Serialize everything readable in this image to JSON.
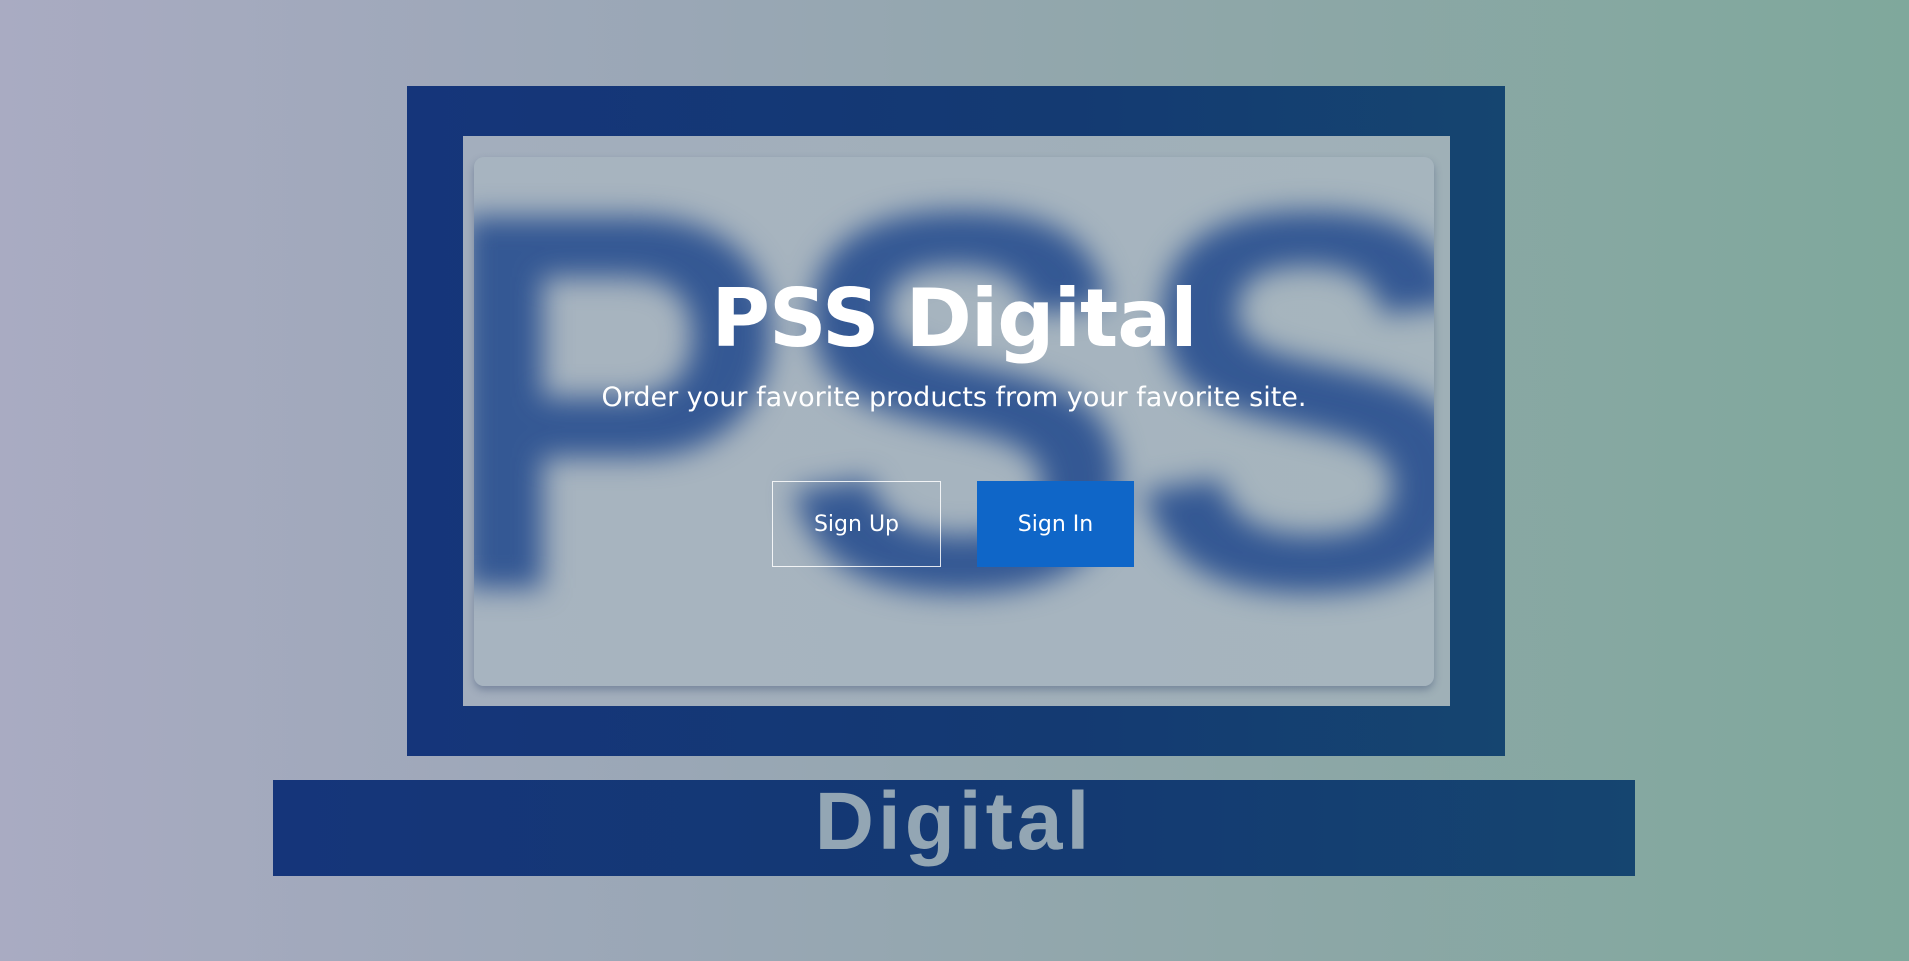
{
  "background_logo": {
    "stand_text": "Digital",
    "screen_text": "PSS"
  },
  "hero": {
    "title": "PSS Digital",
    "subtitle": "Order your favorite products from your favorite site."
  },
  "actions": {
    "sign_up_label": "Sign Up",
    "sign_in_label": "Sign In"
  },
  "colors": {
    "frame_blue": "#15357a",
    "sign_in_blue": "#0f66c8",
    "text": "#ffffff"
  }
}
